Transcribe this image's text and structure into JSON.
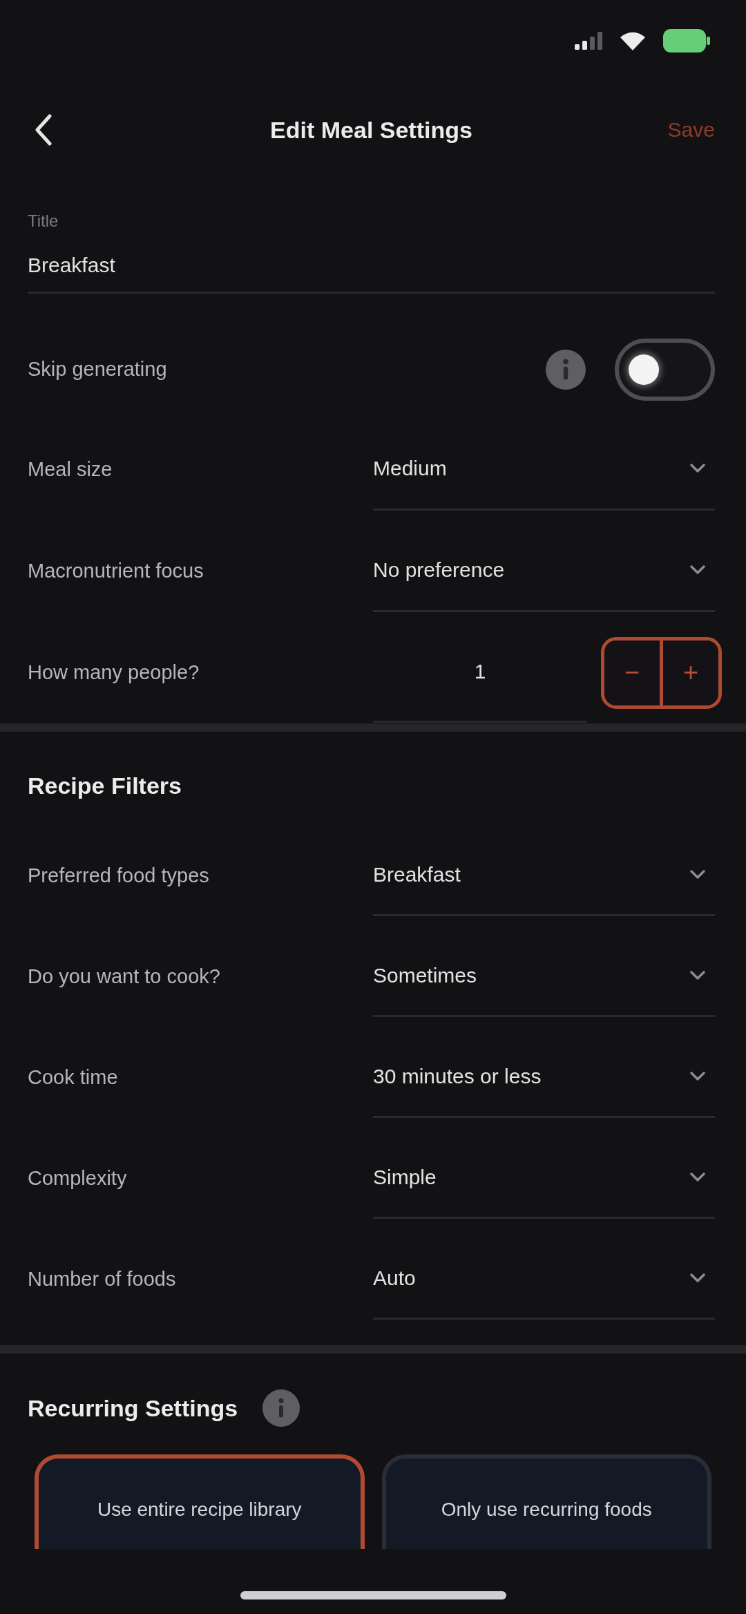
{
  "nav": {
    "title": "Edit Meal Settings",
    "action": "Save"
  },
  "title_field": {
    "label": "Title",
    "value": "Breakfast"
  },
  "skip_generating": {
    "label": "Skip generating",
    "on": false
  },
  "meal_settings": [
    {
      "kind": "select",
      "label": "Meal size",
      "value": "Medium"
    },
    {
      "kind": "select",
      "label": "Macronutrient focus",
      "value": "No preference"
    },
    {
      "kind": "stepper",
      "label": "How many people?",
      "value": "1",
      "decrement": "−",
      "increment": "+"
    }
  ],
  "recipe_filters": {
    "title": "Recipe Filters",
    "rows": [
      {
        "kind": "select",
        "label": "Preferred food types",
        "value": "Breakfast"
      },
      {
        "kind": "select",
        "label": "Do you want to cook?",
        "value": "Sometimes"
      },
      {
        "kind": "select",
        "label": "Cook time",
        "value": "30 minutes or less"
      },
      {
        "kind": "select",
        "label": "Complexity",
        "value": "Simple"
      },
      {
        "kind": "select",
        "label": "Number of foods",
        "value": "Auto"
      }
    ]
  },
  "recurring_settings": {
    "title": "Recurring Settings",
    "options": [
      {
        "label": "Use entire recipe library",
        "selected": true
      },
      {
        "label": "Only use recurring foods",
        "selected": false
      }
    ]
  }
}
